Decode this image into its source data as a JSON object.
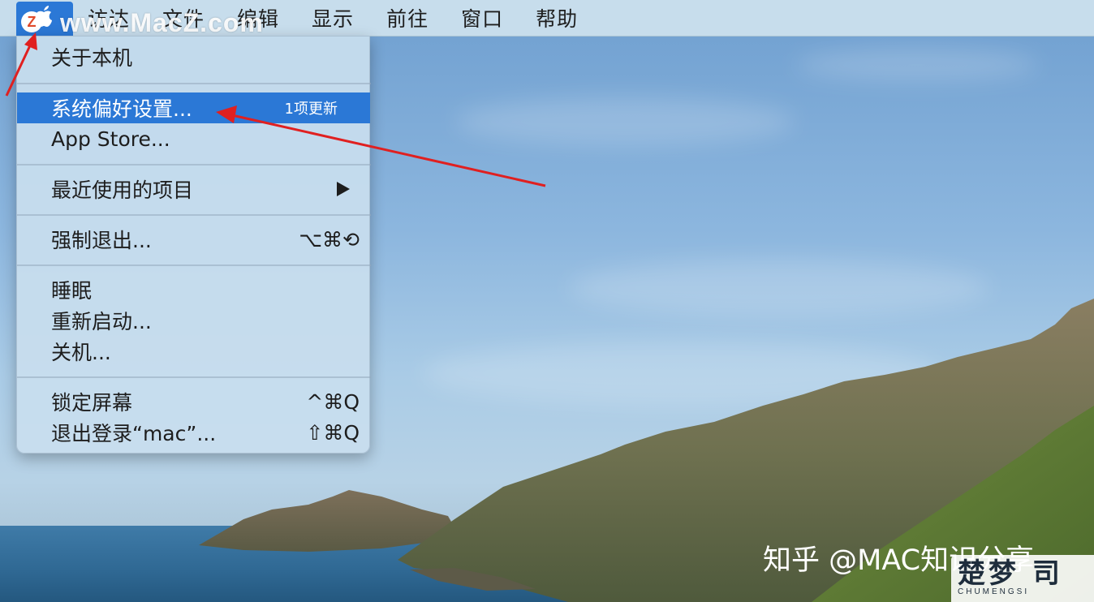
{
  "menubar": {
    "items": [
      "访达",
      "文件",
      "编辑",
      "显示",
      "前往",
      "窗口",
      "帮助"
    ]
  },
  "watermark_top": {
    "badge": "Z",
    "text": "www.MacZ.com"
  },
  "apple_menu": {
    "about": "关于本机",
    "system_prefs": "系统偏好设置...",
    "system_prefs_badge": "1项更新",
    "app_store": "App Store...",
    "recent_items": "最近使用的项目",
    "force_quit": "强制退出...",
    "force_quit_shortcut": "⌥⌘⟲",
    "sleep": "睡眠",
    "restart": "重新启动...",
    "shutdown": "关机...",
    "lock_screen": "锁定屏幕",
    "lock_screen_shortcut": "^⌘Q",
    "logout": "退出登录“mac”...",
    "logout_shortcut": "⇧⌘Q"
  },
  "watermark_bottom": {
    "zhihu": "知乎 @MAC知识分享",
    "badge_big": "楚梦 司",
    "badge_small": "CHUMENGSI"
  },
  "colors": {
    "selection": "#2b78d6",
    "arrow": "#e02020"
  }
}
